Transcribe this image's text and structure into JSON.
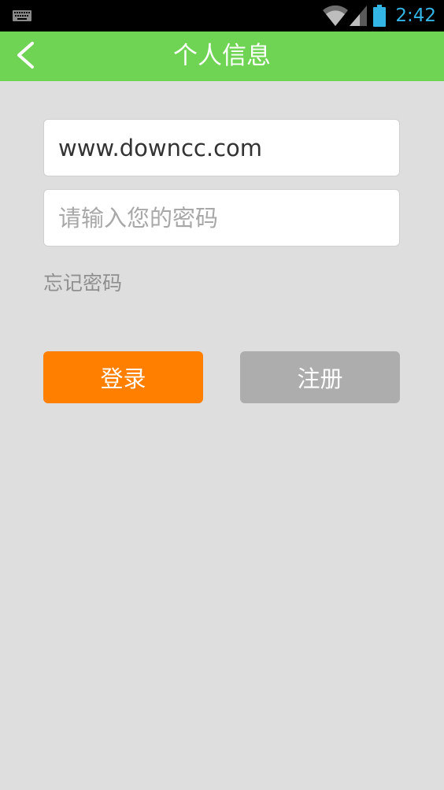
{
  "status_bar": {
    "time": "2:42",
    "icons": [
      "keyboard-icon",
      "wifi-icon",
      "signal-icon",
      "battery-icon"
    ]
  },
  "app_bar": {
    "title": "个人信息",
    "back_icon": "chevron-left-icon"
  },
  "login_form": {
    "username_value": "www.downcc.com",
    "password_placeholder": "请输入您的密码",
    "forgot_password_label": "忘记密码",
    "login_label": "登录",
    "register_label": "注册"
  },
  "colors": {
    "app_bar": "#6fd454",
    "login_button": "#ff7f00",
    "register_button": "#adadad",
    "background": "#dedede",
    "status_time": "#33b5e5"
  }
}
